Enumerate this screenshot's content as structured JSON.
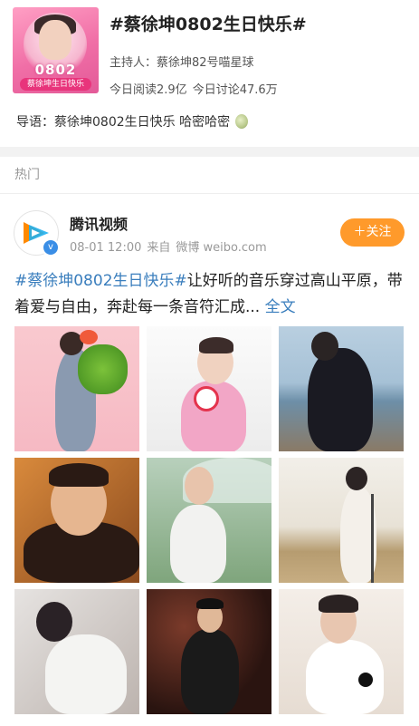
{
  "topic": {
    "title": "#蔡徐坤0802生日快乐#",
    "host_label": "主持人：",
    "host_name": "蔡徐坤82号喵星球",
    "reads": "今日阅读2.9亿",
    "discussions": "今日讨论47.6万",
    "guide_label": "导语：",
    "guide_text": "蔡徐坤0802生日快乐 哈密哈密",
    "cover_date": "0802",
    "cover_ribbon": "蔡徐坤生日快乐",
    "cover_icon": "cantaloupe-icon"
  },
  "section": {
    "label": "热门"
  },
  "post": {
    "author": "腾讯视频",
    "time": "08-01 12:00",
    "source_prefix": "来自",
    "source": "微博 weibo.com",
    "follow_label": "＋关注",
    "hashtag": "#蔡徐坤0802生日快乐#",
    "body": "让好听的音乐穿过高山平原，带着爱与自由，奔赴每一条音符汇成...",
    "more_label": "全文",
    "verified_badge": "v",
    "photos": [
      {
        "name": "balloon-photo"
      },
      {
        "name": "lightstick-photo"
      },
      {
        "name": "seaside-photo"
      },
      {
        "name": "portrait-amber-photo"
      },
      {
        "name": "umbrella-photo"
      },
      {
        "name": "stage-mic-photo"
      },
      {
        "name": "lounge-photo"
      },
      {
        "name": "suit-stage-photo"
      },
      {
        "name": "white-shirt-photo"
      }
    ]
  },
  "colors": {
    "accent_link": "#3a7ebd",
    "follow_button": "#ff9a2b",
    "cover_pink": "#f06ea6"
  }
}
